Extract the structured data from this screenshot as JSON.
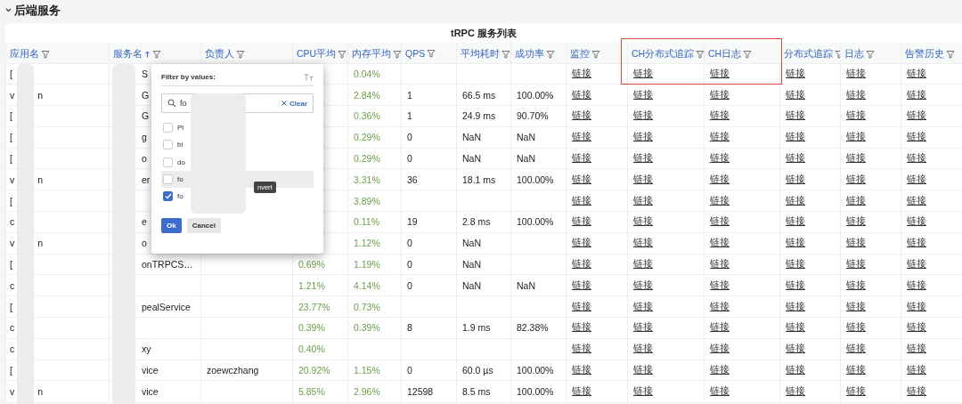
{
  "section": {
    "title": "后端服务",
    "expanded": true
  },
  "table": {
    "title": "tRPC 服务列表",
    "columns": [
      {
        "label": "应用名",
        "sorted_ascending": false,
        "highlighted": false
      },
      {
        "label": "服务名",
        "sorted_ascending": true,
        "highlighted": false
      },
      {
        "label": "负责人",
        "sorted_ascending": false,
        "highlighted": false
      },
      {
        "label": "CPU平均",
        "sorted_ascending": false,
        "highlighted": false
      },
      {
        "label": "内存平均",
        "sorted_ascending": false,
        "highlighted": false
      },
      {
        "label": "QPS",
        "sorted_ascending": false,
        "highlighted": false
      },
      {
        "label": "平均耗时",
        "sorted_ascending": false,
        "highlighted": false
      },
      {
        "label": "成功率",
        "sorted_ascending": false,
        "highlighted": false
      },
      {
        "label": "监控",
        "sorted_ascending": false,
        "highlighted": false
      },
      {
        "label": "CH分布式追踪",
        "sorted_ascending": false,
        "highlighted": true
      },
      {
        "label": "CH日志",
        "sorted_ascending": false,
        "highlighted": true
      },
      {
        "label": "分布式追踪",
        "sorted_ascending": false,
        "highlighted": false
      },
      {
        "label": "日志",
        "sorted_ascending": false,
        "highlighted": false
      },
      {
        "label": "告警历史",
        "sorted_ascending": false,
        "highlighted": false
      }
    ],
    "rows": [
      {
        "app": {
          "prefix": "["
        },
        "service": "S",
        "mem": "0.04%",
        "links": [
          "链接",
          "链接",
          "链接",
          "链接",
          "链接",
          "链接"
        ]
      },
      {
        "app": {
          "prefix": "v",
          "suffix": "n"
        },
        "service": "G",
        "mem": "2.84%",
        "qps": "1",
        "latency": "66.5 ms",
        "success": "100.00%",
        "links": [
          "链接",
          "链接",
          "链接",
          "链接",
          "链接",
          "链接"
        ]
      },
      {
        "app": {
          "prefix": "["
        },
        "service": "G",
        "mem": "0.36%",
        "qps": "1",
        "latency": "24.9 ms",
        "success": "90.70%",
        "links": [
          "链接",
          "链接",
          "链接",
          "链接",
          "链接",
          "链接"
        ]
      },
      {
        "app": {
          "prefix": "["
        },
        "service": "g",
        "mem": "0.29%",
        "qps": "0",
        "latency": "NaN",
        "success": "NaN",
        "links": [
          "链接",
          "链接",
          "链接",
          "链接",
          "链接",
          "链接"
        ]
      },
      {
        "app": {
          "prefix": "["
        },
        "service": "o",
        "mem": "0.29%",
        "qps": "0",
        "latency": "NaN",
        "success": "NaN",
        "links": [
          "链接",
          "链接",
          "链接",
          "链接",
          "链接",
          "链接"
        ]
      },
      {
        "app": {
          "prefix": "v",
          "suffix": "n"
        },
        "service": "er",
        "mem": "3.31%",
        "qps": "36",
        "latency": "18.1 ms",
        "success": "100.00%",
        "links": [
          "链接",
          "链接",
          "链接",
          "链接",
          "链接",
          "链接"
        ]
      },
      {
        "app": {
          "prefix": "["
        },
        "mem": "3.89%",
        "links": [
          "链接",
          "链接",
          "链接",
          "链接",
          "链接",
          "链接"
        ]
      },
      {
        "app": {
          "prefix": "c"
        },
        "service": "e",
        "mem": "0.11%",
        "qps": "19",
        "latency": "2.8 ms",
        "success": "100.00%",
        "links": [
          "链接",
          "链接",
          "链接",
          "链接",
          "链接",
          "链接"
        ]
      },
      {
        "app": {
          "prefix": "v",
          "suffix": "n"
        },
        "service": "o",
        "mem": "1.12%",
        "qps": "0",
        "latency": "NaN",
        "links": [
          "链接",
          "链接",
          "链接",
          "链接",
          "链接",
          "链接"
        ]
      },
      {
        "app": {
          "prefix": "["
        },
        "service": "onTRPCS…",
        "cpu": "0.69%",
        "mem": "1.19%",
        "qps": "0",
        "latency": "NaN",
        "links": [
          "链接",
          "链接",
          "链接",
          "链接",
          "链接",
          "链接"
        ]
      },
      {
        "app": {
          "prefix": "c"
        },
        "cpu": "1.21%",
        "mem": "4.14%",
        "qps": "0",
        "latency": "NaN",
        "success": "NaN",
        "links": [
          "链接",
          "链接",
          "链接",
          "链接",
          "链接",
          "链接"
        ]
      },
      {
        "app": {
          "prefix": "["
        },
        "service": "pealService",
        "cpu": "23.77%",
        "mem": "0.73%",
        "links": [
          "链接",
          "链接",
          "链接",
          "链接",
          "链接",
          "链接"
        ]
      },
      {
        "app": {
          "prefix": "c"
        },
        "cpu": "0.39%",
        "mem": "0.39%",
        "qps": "8",
        "latency": "1.9 ms",
        "success": "82.38%",
        "links": [
          "链接",
          "链接",
          "链接",
          "链接",
          "链接",
          "链接"
        ]
      },
      {
        "app": {
          "prefix": "c"
        },
        "service": "xy",
        "cpu": "0.40%",
        "links": [
          "链接",
          "链接",
          "链接",
          "链接",
          "链接",
          "链接"
        ]
      },
      {
        "app": {
          "prefix": "["
        },
        "service": "vice",
        "owner": "zoewczhang",
        "cpu": "20.92%",
        "mem": "1.15%",
        "qps": "0",
        "latency": "60.0 µs",
        "success": "100.00%",
        "links": [
          "链接",
          "链接",
          "链接",
          "链接",
          "链接",
          "链接"
        ]
      },
      {
        "app": {
          "prefix": "v",
          "suffix": "n"
        },
        "service": "vice",
        "cpu": "5.85%",
        "mem": "2.96%",
        "qps": "12598",
        "latency": "8.5 ms",
        "success": "100.00%",
        "links": [
          "链接",
          "链接",
          "链接",
          "链接",
          "链接",
          "链接"
        ]
      }
    ]
  },
  "filter_popup": {
    "title": "Filter by values:",
    "search": {
      "value": "fo",
      "clear": "Clear"
    },
    "options": [
      {
        "label": "Pl",
        "checked": false,
        "hovered": false
      },
      {
        "label": "bi",
        "checked": false,
        "hovered": false
      },
      {
        "label": "do",
        "checked": false,
        "hovered": false
      },
      {
        "label": "fo",
        "checked": false,
        "hovered": true
      },
      {
        "label": "fo",
        "checked": true,
        "hovered": false
      }
    ],
    "tooltip": "nvert",
    "buttons": [
      {
        "label": "Ok",
        "kind": "primary"
      },
      {
        "label": "Cancel",
        "kind": "secondary"
      }
    ]
  }
}
